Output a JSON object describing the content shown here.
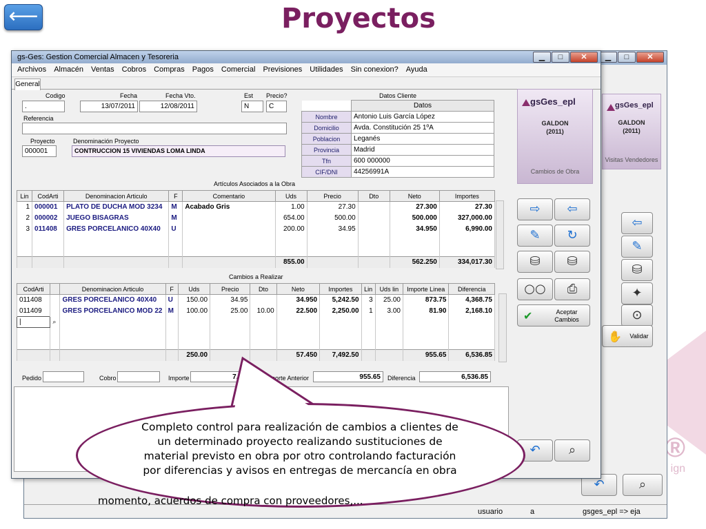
{
  "slide": {
    "title": "Proyectos",
    "back_label": "⟵"
  },
  "bg_logo": {
    "text": "se®",
    "sub": "ign"
  },
  "window_back": {
    "status": {
      "user": "usuario",
      "a": "a",
      "server": "gsges_epl => eja"
    },
    "brand": {
      "name": "gsGes_epl",
      "sub1": "GALDON",
      "sub2": "(2011)",
      "caption": "Visitas Vendedores"
    },
    "validar_label": "Validar"
  },
  "window": {
    "title": "gs-Ges: Gestion Comercial Almacen y Tesoreria",
    "menu": [
      "Archivos",
      "Almacén",
      "Ventas",
      "Cobros",
      "Compras",
      "Pagos",
      "Comercial",
      "Previsiones",
      "Utilidades",
      "Sin conexion?",
      "Ayuda"
    ],
    "tab": "General",
    "header": {
      "codigo_label": "Codigo",
      "codigo": ".",
      "fecha_label": "Fecha",
      "fecha": "13/07/2011",
      "vto_label": "Fecha Vto.",
      "vto": "12/08/2011",
      "est_label": "Est",
      "est": "N",
      "precio_label": "Precio?",
      "precio": "C",
      "referencia_label": "Referencia",
      "referencia": "",
      "proyecto_label": "Proyecto",
      "proyecto": "000001",
      "denom_label": "Denominación Proyecto",
      "denom": "CONTRUCCION 15 VIVIENDAS LOMA LINDA"
    },
    "cliente": {
      "title": "Datos Cliente",
      "col": "Datos",
      "rows": [
        {
          "k": "Nombre",
          "v": "Antonio Luis García López"
        },
        {
          "k": "Domicilio",
          "v": "Avda. Constitución 25 1ºA"
        },
        {
          "k": "Poblacion",
          "v": "Leganés"
        },
        {
          "k": "Provincia",
          "v": "Madrid"
        },
        {
          "k": "Tfn",
          "v": "600 000000"
        },
        {
          "k": "CIF/DNI",
          "v": "44256991A"
        }
      ]
    },
    "articulos": {
      "title": "Artículos Asociados a la Obra",
      "headers": [
        "Lin",
        "CodArti",
        "Denominacion Articulo",
        "F",
        "Comentario",
        "Uds",
        "Precio",
        "Dto",
        "Neto",
        "Importes"
      ],
      "rows": [
        [
          "1",
          "000001",
          "PLATO DE DUCHA MOD 3234",
          "M",
          "Acabado Gris",
          "1.00",
          "27.30",
          "",
          "27.300",
          "27.30"
        ],
        [
          "2",
          "000002",
          "JUEGO BISAGRAS",
          "M",
          "",
          "654.00",
          "500.00",
          "",
          "500.000",
          "327,000.00"
        ],
        [
          "3",
          "011408",
          "GRES PORCELANICO 40X40",
          "U",
          "",
          "200.00",
          "34.95",
          "",
          "34.950",
          "6,990.00"
        ]
      ],
      "totals": {
        "uds": "855.00",
        "neto": "562.250",
        "importes": "334,017.30"
      }
    },
    "cambios": {
      "title": "Cambios a Realizar",
      "headers": [
        "CodArti",
        "",
        "Denominacion Articulo",
        "F",
        "Uds",
        "Precio",
        "Dto",
        "Neto",
        "Importes",
        "Lin",
        "Uds lin",
        "Importe Linea",
        "Diferencia"
      ],
      "rows": [
        [
          "011408",
          "",
          "GRES PORCELANICO 40X40",
          "U",
          "150.00",
          "34.95",
          "",
          "34.950",
          "5,242.50",
          "3",
          "25.00",
          "873.75",
          "4,368.75"
        ],
        [
          "011409",
          "",
          "GRES PORCELANICO MOD 22",
          "M",
          "100.00",
          "25.00",
          "10.00",
          "22.500",
          "2,250.00",
          "1",
          "3.00",
          "81.90",
          "2,168.10"
        ]
      ],
      "totals": {
        "uds": "250.00",
        "neto": "57.450",
        "importes": "7,492.50",
        "importe_linea": "955.65",
        "diferencia": "6,536.85"
      }
    },
    "footer": {
      "pedido_label": "Pedido",
      "pedido": "",
      "cobro_label": "Cobro",
      "cobro": "",
      "importe_label": "Importe",
      "importe": "7,492.50",
      "anterior_label": "Importe Anterior",
      "anterior": "955.65",
      "diferencia_label": "Diferencia",
      "diferencia": "6,536.85"
    },
    "brand": {
      "name": "gsGes_epl",
      "sub1": "GALDON",
      "sub2": "(2011)",
      "caption": "Cambios de Obra"
    },
    "aceptar_label": "Aceptar Cambios"
  },
  "bubble": {
    "text": "Completo control para realización de cambios a clientes de un determinado proyecto realizando sustituciones de material previsto en obra por otro controlando facturación por diferencias y avisos en entregas de mercancía en obra",
    "ghost": "momento, acuerdos de compra con proveedores,..."
  }
}
